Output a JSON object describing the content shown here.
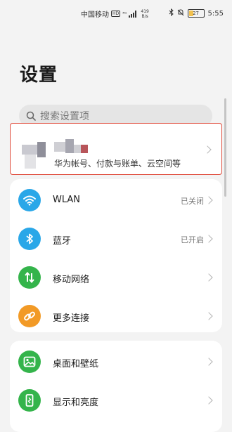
{
  "status_bar": {
    "carrier": "中国移动",
    "hd": "HD",
    "speed_value": "419",
    "speed_unit": "B/s",
    "battery": "27",
    "time": "5:55"
  },
  "header": {
    "title": "设置"
  },
  "search": {
    "placeholder": "搜索设置项"
  },
  "account": {
    "subtitle": "华为帐号、付款与账单、云空间等"
  },
  "network_items": [
    {
      "label": "WLAN",
      "status": "已关闭",
      "icon": "wifi-icon",
      "color": "#2aa7e8"
    },
    {
      "label": "蓝牙",
      "status": "已开启",
      "icon": "bluetooth-icon",
      "color": "#2aa7e8"
    },
    {
      "label": "移动网络",
      "status": "",
      "icon": "mobile-data-icon",
      "color": "#34b44b"
    },
    {
      "label": "更多连接",
      "status": "",
      "icon": "link-icon",
      "color": "#f29a26"
    }
  ],
  "display_items": [
    {
      "label": "桌面和壁纸",
      "icon": "wallpaper-icon",
      "color": "#34b44b"
    },
    {
      "label": "显示和亮度",
      "icon": "display-icon",
      "color": "#34b44b"
    }
  ]
}
